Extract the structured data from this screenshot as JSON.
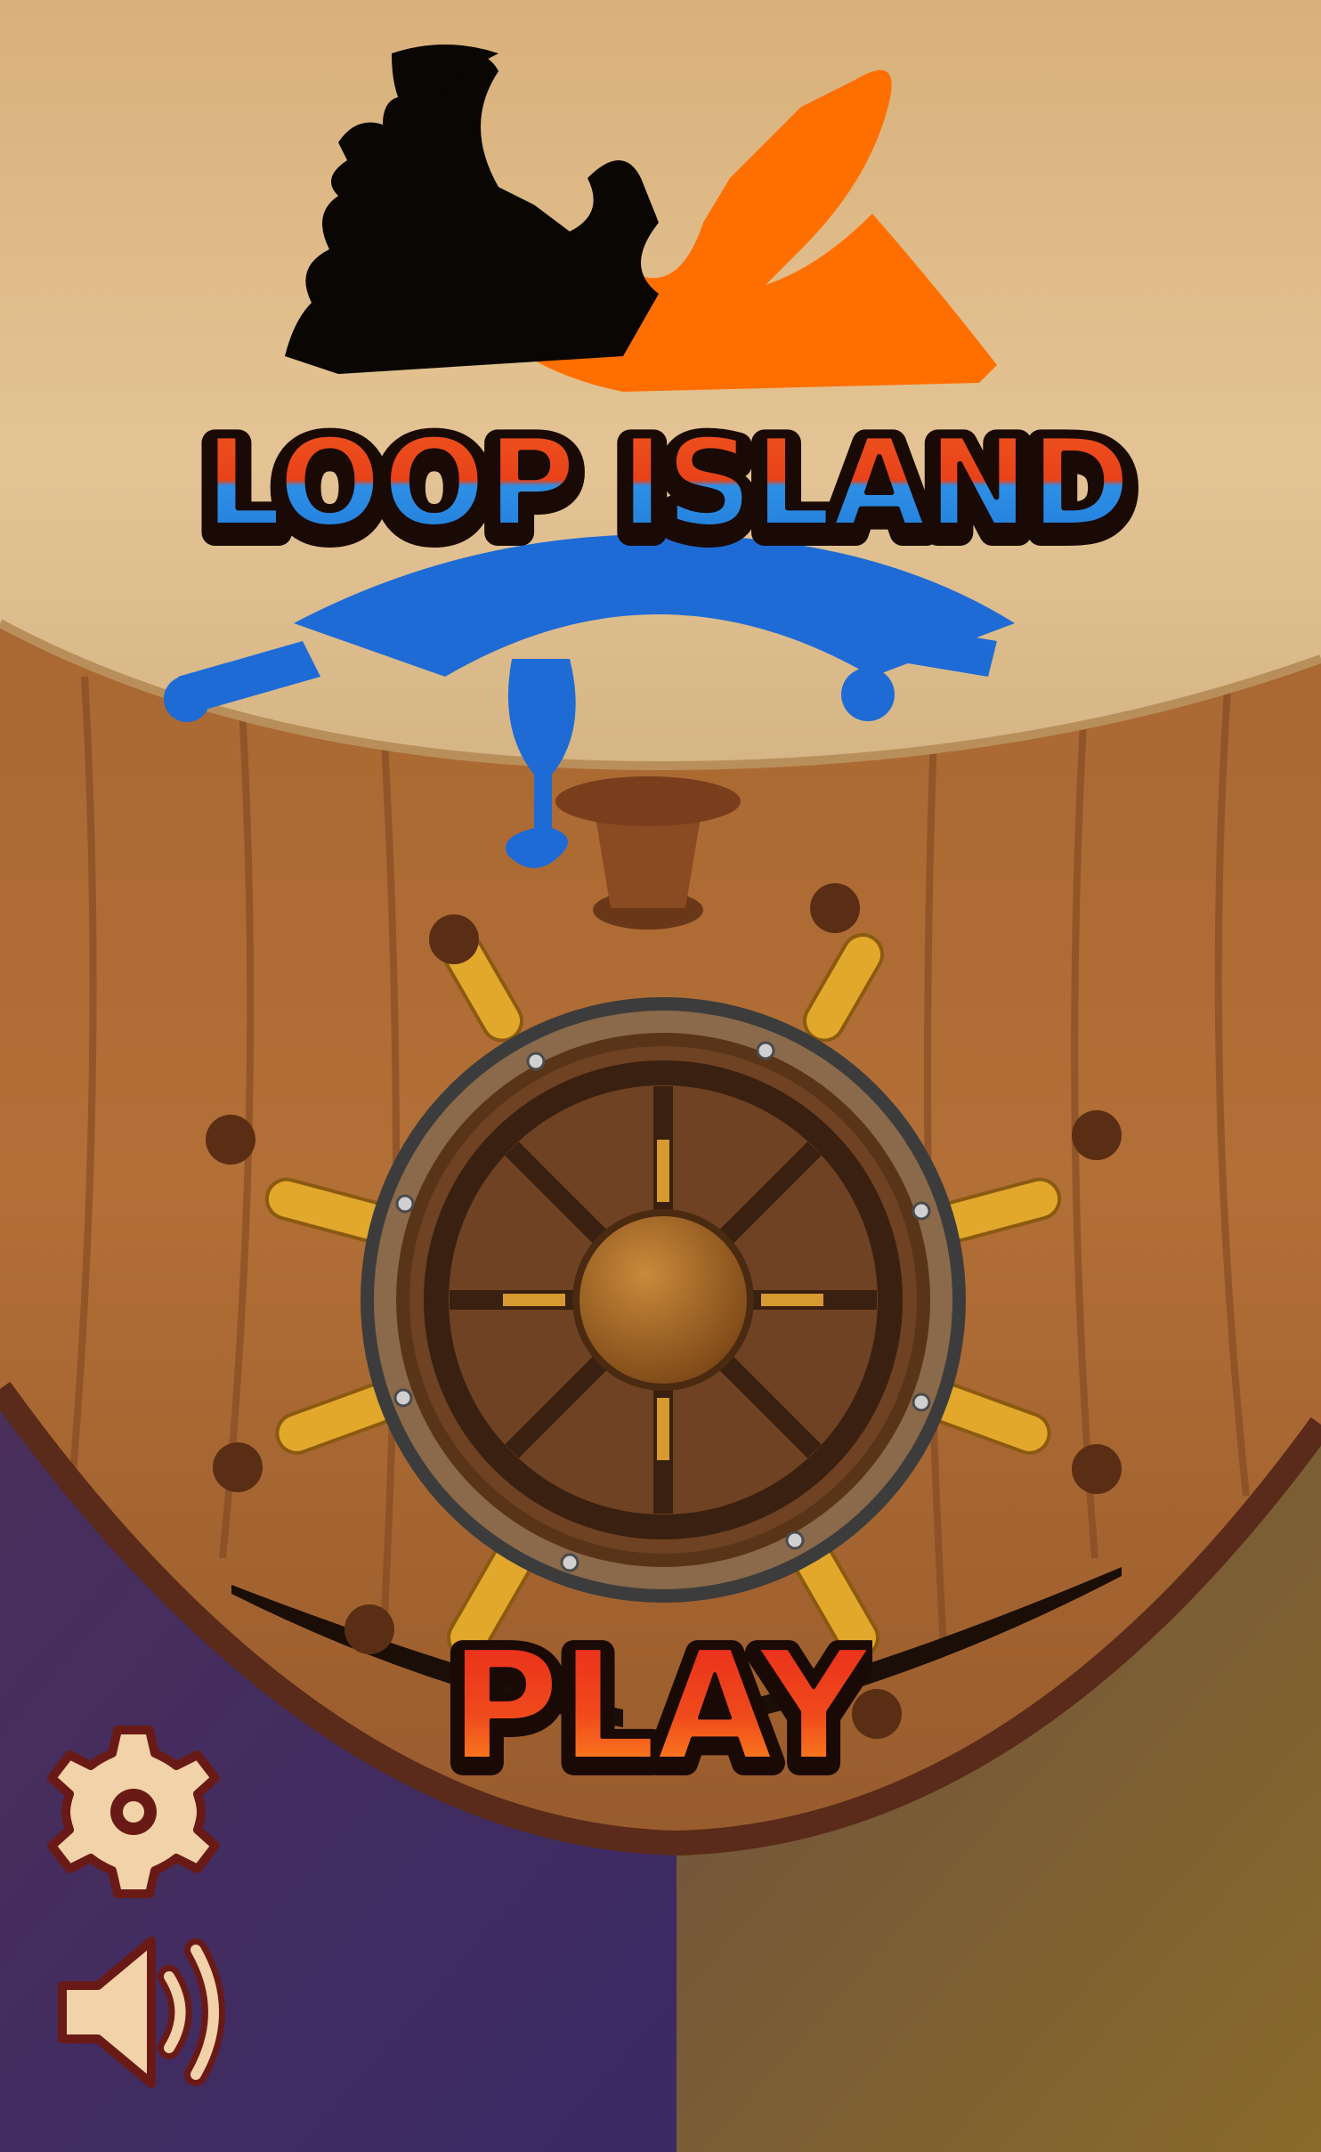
{
  "game": {
    "title": "LOOP ISLAND",
    "play_label": "PLAY"
  },
  "icons": {
    "settings": "gear-icon",
    "sound": "speaker-icon"
  },
  "colors": {
    "title_top": "#f04a1e",
    "title_bottom": "#2a8fe8",
    "play_fill": "#e8321c",
    "play_highlight": "#ff9a1e",
    "outline": "#1a0a06",
    "sail": "#e0c08e",
    "wood": "#9a5a2a",
    "orange_silhouette": "#ff6f00",
    "blue_silhouette": "#1e6bd6",
    "icon_fill": "#f2d2a8",
    "icon_outline": "#6a1a16"
  }
}
